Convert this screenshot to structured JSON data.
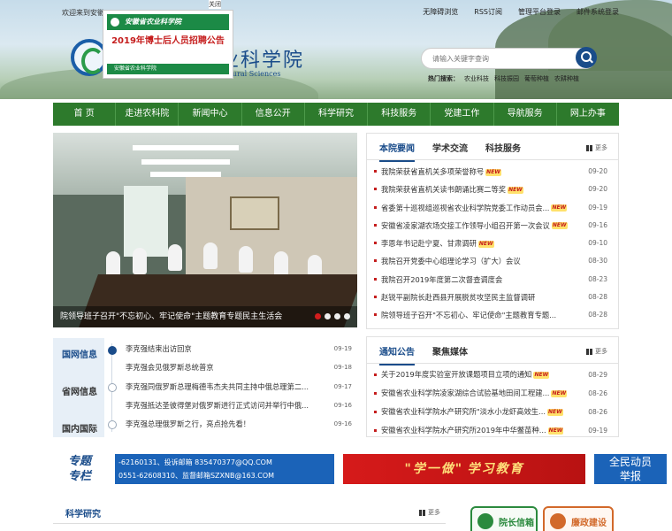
{
  "header": {
    "welcome": "欢迎来到安徽",
    "top_links": [
      "无障碍浏览",
      "RSS订阅",
      "管理平台登录",
      "邮件系统登录"
    ],
    "logo_text": "业科学院",
    "logo_en": "ultural Sciences",
    "search_placeholder": "请输入关键字查询",
    "hot_label": "热门搜索：",
    "hot_items": [
      "农业科技",
      "科技振园",
      "葡萄种植",
      "农耕种植"
    ]
  },
  "popup": {
    "org": "安徽省农业科学院",
    "headline": "2019年博士后人员招聘公告",
    "footer": "安徽省农业科学院",
    "close_label": "关闭"
  },
  "nav": {
    "items": [
      "首 页",
      "走进农科院",
      "新闻中心",
      "信息公开",
      "科学研究",
      "科技服务",
      "党建工作",
      "导航服务",
      "网上办事"
    ]
  },
  "slider": {
    "caption": "院领导班子召开\"不忘初心、牢记使命\"主题教育专题民主生活会",
    "dots": 4,
    "active_dot": 1
  },
  "news": {
    "tabs": [
      "本院要闻",
      "学术交流",
      "科技服务"
    ],
    "more_label": "更多",
    "new_badge": "NEW",
    "items": [
      {
        "title": "我院荣获省直机关多项荣誉称号",
        "date": "09-20",
        "is_new": true
      },
      {
        "title": "我院荣获省直机关读书朗诵比赛二等奖",
        "date": "09-20",
        "is_new": true
      },
      {
        "title": "省委第十巡视组巡视省农业科学院党委工作动员会...",
        "date": "09-19",
        "is_new": true
      },
      {
        "title": "安徽省凌家湖农场交接工作领导小组召开第一次会议",
        "date": "09-16",
        "is_new": true
      },
      {
        "title": "李恩年书记赴宁夏、甘肃调研",
        "date": "09-10",
        "is_new": true
      },
      {
        "title": "我院召开党委中心组理论学习（扩大）会议",
        "date": "08-30",
        "is_new": false
      },
      {
        "title": "我院召开2019年度第二次督查调度会",
        "date": "08-23",
        "is_new": false
      },
      {
        "title": "赵锐平副院长赴西县开展脱贫攻坚民主监督调研",
        "date": "08-28",
        "is_new": false
      },
      {
        "title": "院领导班子召开\"不忘初心、牢记使命\"主题教育专题...",
        "date": "08-28",
        "is_new": false
      }
    ]
  },
  "info": {
    "categories": [
      "国网信息",
      "省网信息",
      "国内国际"
    ],
    "items": [
      {
        "title": "李克强结束出访回京",
        "date": "09-19"
      },
      {
        "title": "李克强会见俄罗斯总统普京",
        "date": "09-18"
      },
      {
        "title": "李克强同俄罗斯总理梅德韦杰夫共同主持中俄总理第二...",
        "date": "09-17"
      },
      {
        "title": "李克强抵达圣彼得堡对俄罗斯进行正式访问并举行中俄...",
        "date": "09-16"
      },
      {
        "title": "李克强总理俄罗斯之行，亮点抢先看！",
        "date": "09-16"
      }
    ]
  },
  "notice": {
    "tabs": [
      "通知公告",
      "聚焦媒体"
    ],
    "more_label": "更多",
    "items": [
      {
        "title": "关于2019年度实验室开放课题项目立项的通知",
        "date": "08-29",
        "is_new": true
      },
      {
        "title": "安徽省农业科学院凌家湖综合试验基地田间工程建...",
        "date": "08-26",
        "is_new": true
      },
      {
        "title": "安徽省农业科学院水产研究所\"淡水小龙虾高效生...",
        "date": "08-26",
        "is_new": true
      },
      {
        "title": "安徽省农业科学院水产研究所2019年中华鳖苗种...",
        "date": "09-19",
        "is_new": true
      }
    ]
  },
  "banners": {
    "zt_line1": "专题",
    "zt_line2": "专栏",
    "contact_line1": "-62160131、投诉邮箱 835470377@QQ.COM",
    "contact_line2": "0551-62608310、监督邮箱SZXNB@163.COM",
    "study_label": "学习教育",
    "study_quote": "\"学一做\"",
    "report_line1": "全民动员",
    "report_line2": "举报"
  },
  "science": {
    "title": "科学研究",
    "more_label": "更多"
  },
  "side_buttons": {
    "mailbox": "院长信箱",
    "suggest": "廉政建设"
  }
}
